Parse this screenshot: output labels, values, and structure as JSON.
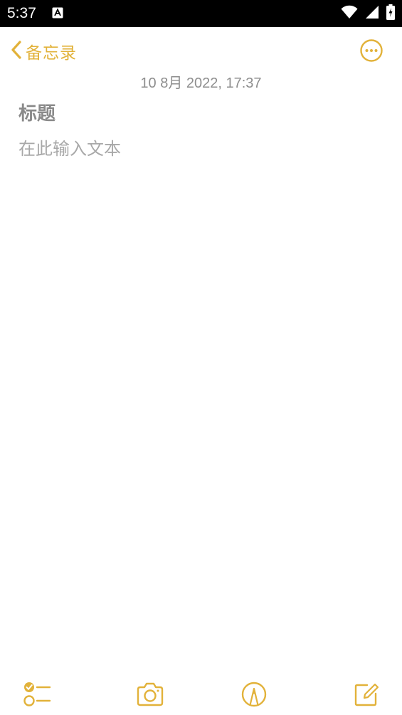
{
  "status": {
    "time": "5:37",
    "notification_icon": "a-icon",
    "icons": [
      "wifi-icon",
      "signal-icon",
      "battery-charging-icon"
    ]
  },
  "nav": {
    "back_label": "备忘录",
    "back_icon": "chevron-left-icon",
    "more_icon": "more-circle-icon"
  },
  "note": {
    "date": "10 8月 2022, 17:37",
    "title_placeholder": "标题",
    "body_placeholder": "在此输入文本"
  },
  "toolbar": {
    "items": [
      "checklist-icon",
      "camera-icon",
      "markup-pen-icon",
      "compose-icon"
    ]
  },
  "colors": {
    "accent": "#e2b23a",
    "status_bar": "#000000",
    "background": "#ffffff",
    "date_text": "#8e8e8e",
    "title_text": "#8a8a8a",
    "body_text": "#a8a8a8"
  }
}
